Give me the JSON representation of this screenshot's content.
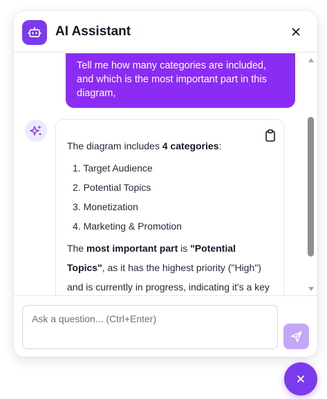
{
  "header": {
    "title": "AI Assistant",
    "bot_icon": "robot-icon",
    "close_icon": "close-icon"
  },
  "user_message": {
    "text": "Tell me how many categories are included, and which is the most important part in this diagram,"
  },
  "assistant_message": {
    "intro_prefix": "The diagram includes ",
    "intro_bold": "4 categories",
    "intro_suffix": ":",
    "categories": [
      "1.  Target Audience",
      "2.  Potential Topics",
      "3.  Monetization",
      "4.  Marketing & Promotion"
    ],
    "summary_prefix": "The ",
    "summary_bold1": "most important part",
    "summary_mid": " is ",
    "summary_bold2": "\"Potential Topics\"",
    "summary_suffix": ", as it has the highest priority (\"High\") and is currently in progress, indicating it's a key focus area for content development.",
    "copy_icon": "clipboard-icon",
    "avatar_icon": "sparkles-icon"
  },
  "input": {
    "placeholder": "Ask a question... (Ctrl+Enter)",
    "value": ""
  },
  "send_icon": "send-icon",
  "fab_icon": "close-icon",
  "colors": {
    "accent": "#7c3aed",
    "user_bubble": "#8b2cf5",
    "send_disabled": "#c4a6f7",
    "avatar_bg": "#ede9fe"
  }
}
